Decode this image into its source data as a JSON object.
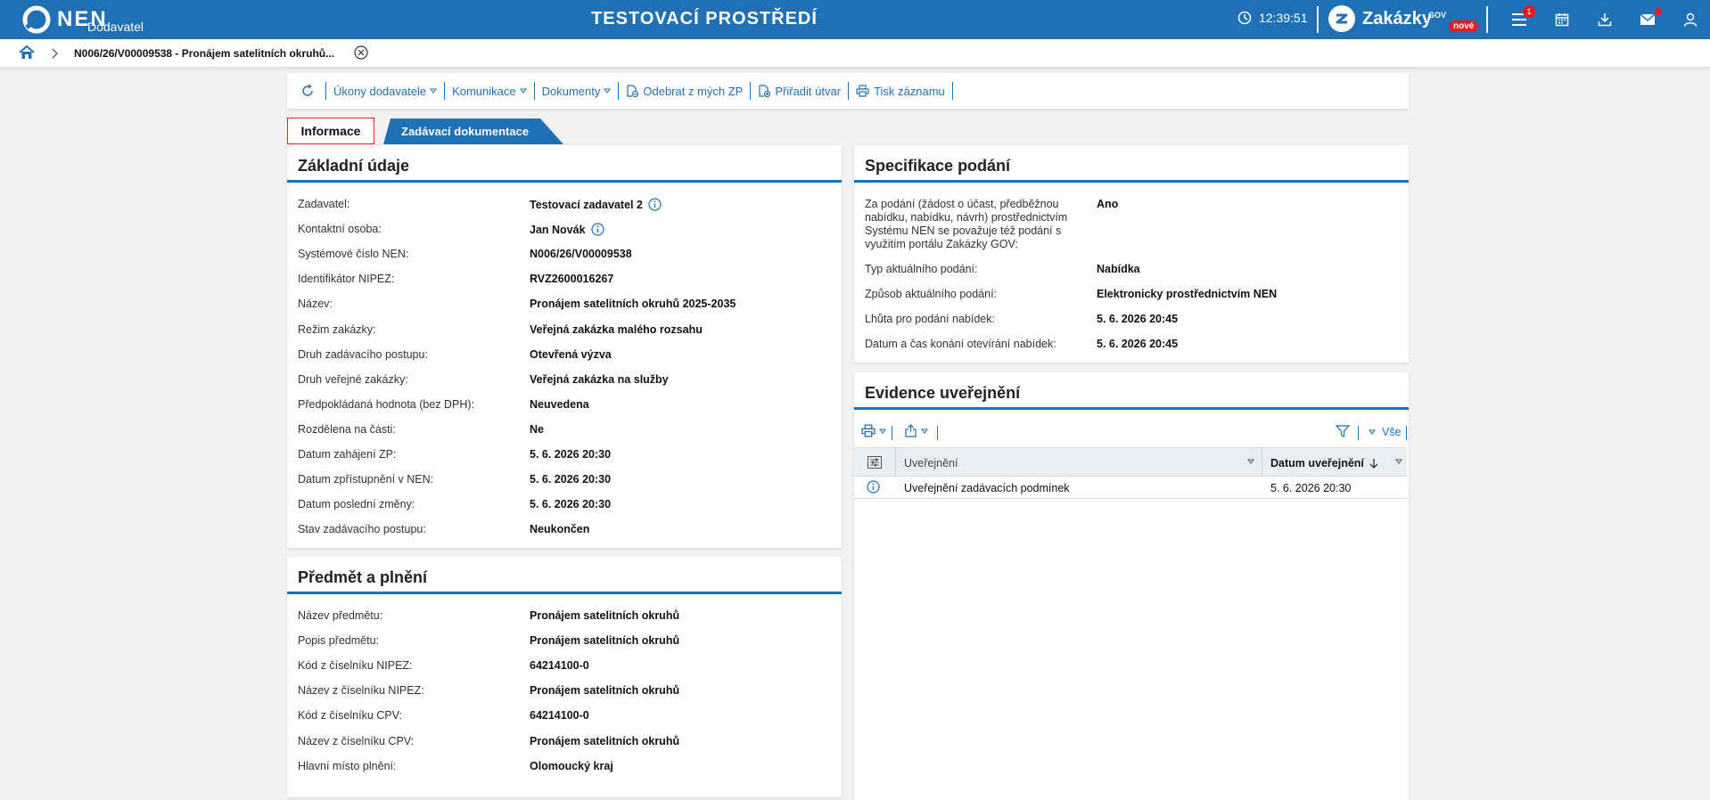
{
  "header": {
    "logo_text": "NEN",
    "logo_sub": "Dodavatel",
    "env_title": "TESTOVACÍ PROSTŘEDÍ",
    "clock": "12:39:51",
    "zakazky": "Zakázky",
    "zakazky_gov": "GOV",
    "zakazky_new": "nové",
    "menu_badge": "1",
    "brand_color": "#1f70b4"
  },
  "breadcrumb": {
    "current": "N006/26/V00009538 - Pronájem satelitních okruhů..."
  },
  "toolbar": {
    "ukony": "Úkony dodavatele",
    "komunikace": "Komunikace",
    "dokumenty": "Dokumenty",
    "odebrat": "Odebrat z mých ZP",
    "priradit": "Přiřadit útvar",
    "tisk": "Tisk záznamu"
  },
  "tabs": {
    "active": "Informace",
    "other": "Zadávací dokumentace"
  },
  "zakladni": {
    "title": "Základní údaje",
    "rows": [
      {
        "label": "Zadavatel:",
        "value": "Testovací zadavatel 2"
      },
      {
        "label": "Kontaktní osoba:",
        "value": "Jan Novák"
      },
      {
        "label": "Systémové číslo NEN:",
        "value": "N006/26/V00009538"
      },
      {
        "label": "Identifikátor NIPEZ:",
        "value": "RVZ2600016267"
      },
      {
        "label": "Název:",
        "value": "Pronájem satelitních okruhů 2025-2035"
      },
      {
        "label": "Režim zakázky:",
        "value": "Veřejná zakázka malého rozsahu"
      },
      {
        "label": "Druh zadávacího postupu:",
        "value": "Otevřená výzva"
      },
      {
        "label": "Druh veřejné zakázky:",
        "value": "Veřejná zakázka na služby"
      },
      {
        "label": "Předpokládaná hodnota (bez DPH):",
        "value": "Neuvedena"
      },
      {
        "label": "Rozdělena na části:",
        "value": "Ne"
      },
      {
        "label": "Datum zahájení ZP:",
        "value": "5. 6. 2026 20:30"
      },
      {
        "label": "Datum zpřístupnění v NEN:",
        "value": "5. 6. 2026 20:30"
      },
      {
        "label": "Datum poslední změny:",
        "value": "5. 6. 2026 20:30"
      },
      {
        "label": "Stav zadávacího postupu:",
        "value": "Neukončen"
      }
    ]
  },
  "predmet": {
    "title": "Předmět a plnění",
    "rows": [
      {
        "label": "Název předmětu:",
        "value": "Pronájem satelitních okruhů"
      },
      {
        "label": "Popis předmětu:",
        "value": "Pronájem satelitních okruhů"
      },
      {
        "label": "Kód z číselníku NIPEZ:",
        "value": "64214100-0"
      },
      {
        "label": "Název z číselníku NIPEZ:",
        "value": "Pronájem satelitních okruhů"
      },
      {
        "label": "Kód z číselníku CPV:",
        "value": "64214100-0"
      },
      {
        "label": "Název z číselníku CPV:",
        "value": "Pronájem satelitních okruhů"
      },
      {
        "label": "Hlavní místo plnění:",
        "value": "Olomoucký kraj"
      }
    ]
  },
  "specifikace": {
    "title": "Specifikace podání",
    "rows": [
      {
        "label": "Za podání (žádost o účast, předběžnou nabídku, nabídku, návrh) prostřednictvím Systému NEN se považuje též podání s využitím portálu Zakázky GOV:",
        "value": "Ano"
      },
      {
        "label": "Typ aktuálního podání:",
        "value": "Nabídka"
      },
      {
        "label": "Způsob aktuálního podání:",
        "value": "Elektronicky prostřednictvím NEN"
      },
      {
        "label": "Lhůta pro podání nabídek:",
        "value": "5. 6. 2026 20:45"
      },
      {
        "label": "Datum a čas konání otevírání nabídek:",
        "value": "5. 6. 2026 20:45"
      }
    ]
  },
  "evidence": {
    "title": "Evidence uveřejnění",
    "filter_all": "Vše",
    "col_uverejneni": "Uveřejnění",
    "col_datum": "Datum uveřejnění",
    "rows": [
      {
        "name": "Uveřejnění zadávacích podmínek",
        "date": "5. 6. 2026 20:30"
      }
    ]
  }
}
